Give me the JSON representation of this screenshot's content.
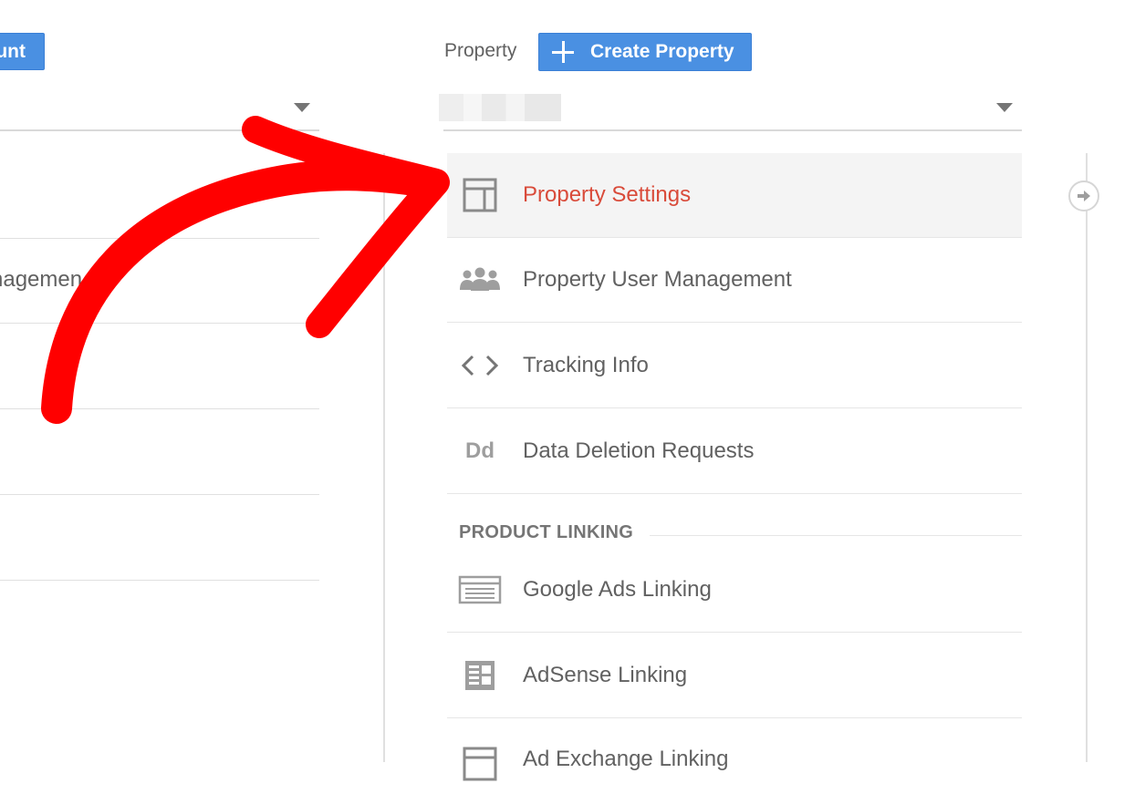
{
  "account_column": {
    "create_button_label": "unt",
    "items": [
      {
        "label": "nagemen"
      }
    ]
  },
  "property_column": {
    "header_label": "Property",
    "create_button_label": "Create Property",
    "selected_property": "",
    "menu": [
      {
        "label": "Property Settings",
        "icon": "layout-icon",
        "active": true
      },
      {
        "label": "Property User Management",
        "icon": "people-icon",
        "active": false
      },
      {
        "label": "Tracking Info",
        "icon": "code-brackets-icon",
        "active": false
      },
      {
        "label": "Data Deletion Requests",
        "icon": "dd-icon",
        "active": false
      }
    ],
    "section_title": "PRODUCT LINKING",
    "linking": [
      {
        "label": "Google Ads Linking",
        "icon": "ads-icon"
      },
      {
        "label": "AdSense Linking",
        "icon": "adsense-icon"
      },
      {
        "label": "Ad Exchange Linking",
        "icon": "ad-exchange-icon"
      }
    ]
  },
  "colors": {
    "primary_button": "#4a90e2",
    "active_item_text": "#d94b3a",
    "annotation_arrow": "#ff0000"
  }
}
